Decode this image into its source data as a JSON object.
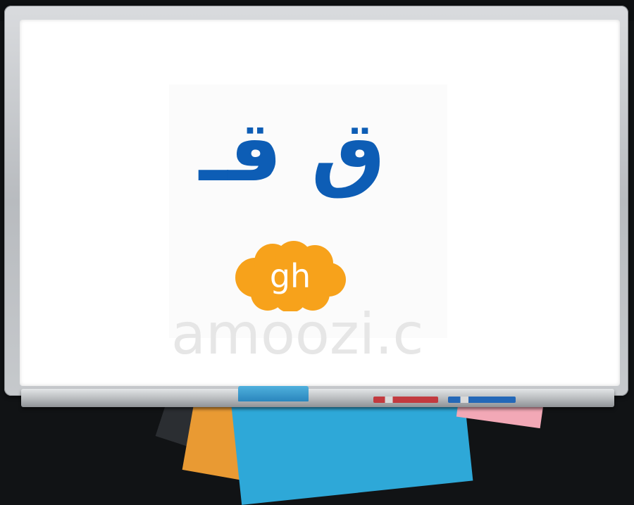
{
  "lesson": {
    "arabic_letters": "ق قـ",
    "transliteration": "gh",
    "watermark": "amoozi.c"
  },
  "colors": {
    "letter": "#0d5db5",
    "cloud": "#f7a21b",
    "board": "#ffffff",
    "eraser": "#2a86bd",
    "marker_red": "#c23a3f",
    "marker_blue": "#2468b8"
  },
  "icons": [
    "cloud-shape",
    "eraser-icon",
    "red-marker-icon",
    "blue-marker-icon"
  ]
}
